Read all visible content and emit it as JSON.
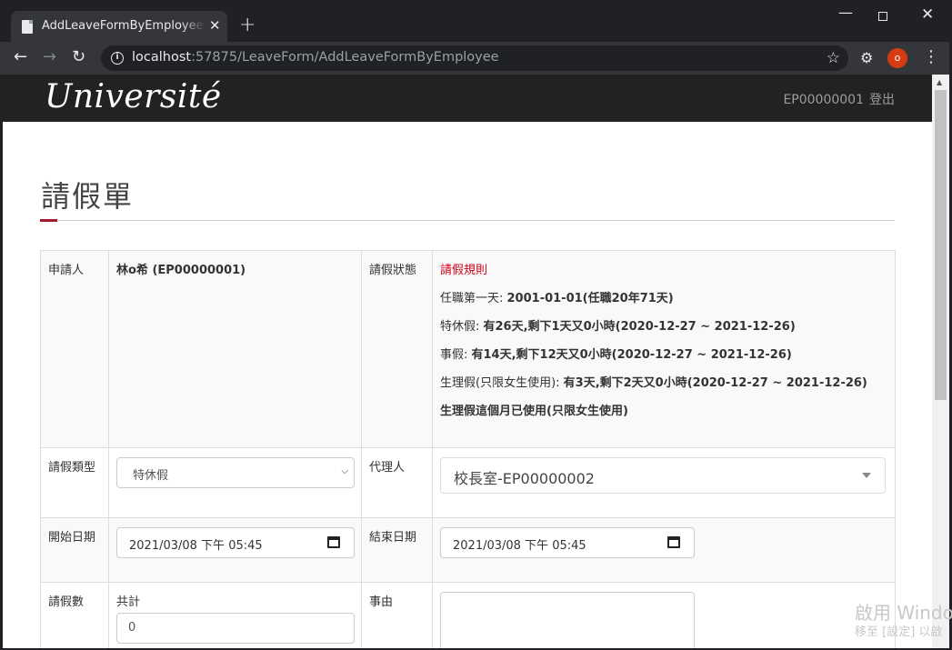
{
  "browser": {
    "tab_title": "AddLeaveFormByEmployee - M",
    "tab_close": "✕",
    "new_tab": "+",
    "url_host": "localhost",
    "url_path": ":57875/LeaveForm/AddLeaveFormByEmployee",
    "profile_initial": "o",
    "win_minimize": "—",
    "win_close": "✕"
  },
  "navbar": {
    "brand": "Université",
    "user_id": "EP00000001",
    "logout": "登出"
  },
  "page": {
    "heading": "請假單"
  },
  "form": {
    "applicant_label": "申請人",
    "applicant_value": "林o希 (EP00000001)",
    "status_label": "請假狀態",
    "rules_title": "請假規則",
    "rules": [
      {
        "prefix": "任職第一天: ",
        "text": "2001-01-01(任職20年71天)"
      },
      {
        "prefix": "特休假: ",
        "text": "有26天,剩下1天又0小時(2020-12-27 ~ 2021-12-26)"
      },
      {
        "prefix": "事假: ",
        "text": "有14天,剩下12天又0小時(2020-12-27 ~ 2021-12-26)"
      },
      {
        "prefix": "生理假(只限女生使用): ",
        "text": "有3天,剩下2天又0小時(2020-12-27 ~ 2021-12-26)"
      },
      {
        "prefix": "",
        "text": "生理假這個月已使用(只限女生使用)"
      }
    ],
    "leave_type_label": "請假類型",
    "leave_type_value": "特休假",
    "agent_label": "代理人",
    "agent_value": "校長室-EP00000002",
    "start_label": "開始日期",
    "start_value": "2021/03/08  下午 05:45",
    "end_label": "結束日期",
    "end_value": "2021/03/08  下午 05:45",
    "days_label": "請假數",
    "total_label": "共計",
    "total_value": "0",
    "reason_label": "事由"
  },
  "watermark": {
    "line1": "啟用 Windo",
    "line2": "移至 [設定] 以啟"
  }
}
